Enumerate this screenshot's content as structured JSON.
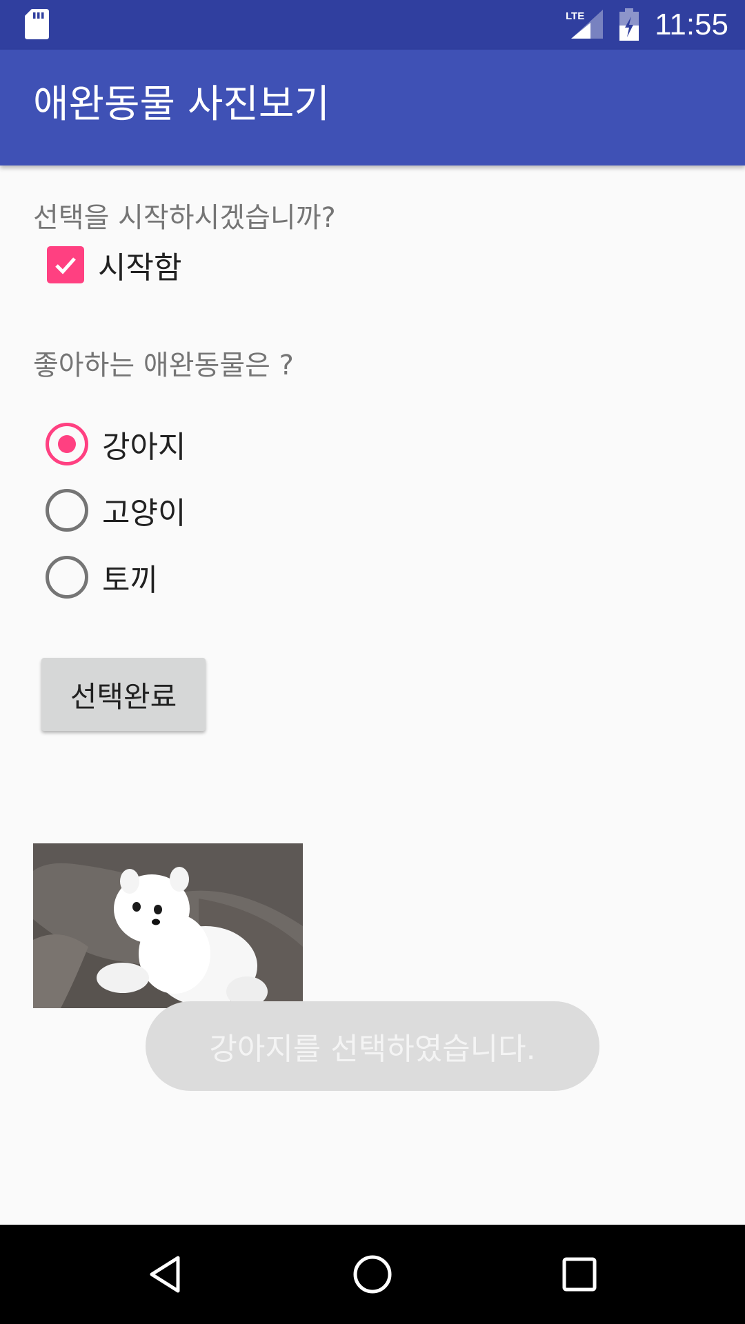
{
  "status_bar": {
    "time": "11:55",
    "network_label": "LTE",
    "icons": [
      "sd-card-icon",
      "lte-signal-icon",
      "battery-charging-icon"
    ]
  },
  "toolbar": {
    "title": "애완동물 사진보기"
  },
  "start_section": {
    "question": "선택을 시작하시겠습니까?",
    "checkbox_label": "시작함",
    "checked": true
  },
  "pet_section": {
    "question": "좋아하는 애완동물은 ?",
    "options": [
      {
        "label": "강아지",
        "selected": true
      },
      {
        "label": "고양이",
        "selected": false
      },
      {
        "label": "토끼",
        "selected": false
      }
    ]
  },
  "done_button": {
    "label": "선택완료"
  },
  "pet_image": {
    "icon": "white-puppy-photo"
  },
  "toast": {
    "message": "강아지를 선택하였습니다."
  },
  "nav_bar": {
    "icons": [
      "back-triangle-icon",
      "home-circle-icon",
      "recents-square-icon"
    ]
  },
  "colors": {
    "status_bar": "#303f9f",
    "toolbar": "#3f51b5",
    "accent": "#ff4081",
    "background": "#fafafa",
    "button": "#d6d7d7",
    "toast": "#dcdcdc"
  }
}
